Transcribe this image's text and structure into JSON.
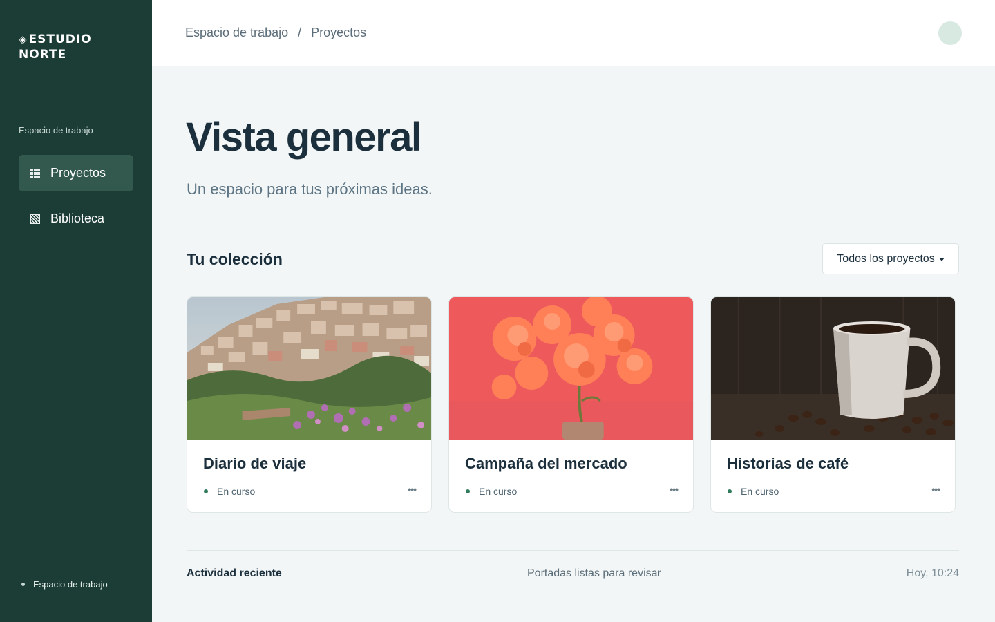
{
  "brand": {
    "symbol": "◈",
    "line1": "ESTUDIO",
    "line2": "NORTE"
  },
  "sidebar": {
    "section_label": "Espacio de trabajo",
    "items": [
      {
        "label": "Proyectos",
        "icon": "grid-icon",
        "active": true
      },
      {
        "label": "Biblioteca",
        "icon": "library-icon",
        "active": false
      }
    ],
    "footer_label": "Espacio de trabajo"
  },
  "header": {
    "breadcrumb": [
      "Espacio de trabajo",
      "Proyectos"
    ],
    "separator": "/"
  },
  "main": {
    "title": "Vista general",
    "subtitle": "Un espacio para tus próximas ideas.",
    "collection_title": "Tu colección",
    "filter_label": "Todos los proyectos"
  },
  "cards": [
    {
      "title": "Diario de viaje",
      "status": "En curso",
      "more": "•••",
      "image": "coastal-village-photo"
    },
    {
      "title": "Campaña del mercado",
      "status": "En curso",
      "more": "•••",
      "image": "coral-flowers-photo"
    },
    {
      "title": "Historias de café",
      "status": "En curso",
      "more": "•••",
      "image": "coffee-cup-photo"
    }
  ],
  "activity": {
    "label": "Actividad reciente",
    "text": "Portadas listas para revisar",
    "time": "Hoy, 10:24"
  },
  "colors": {
    "sidebar_bg": "#1b3d35",
    "sidebar_active": "#33594f",
    "status_dot": "#2f7b5b",
    "page_bg": "#f3f6f6"
  }
}
